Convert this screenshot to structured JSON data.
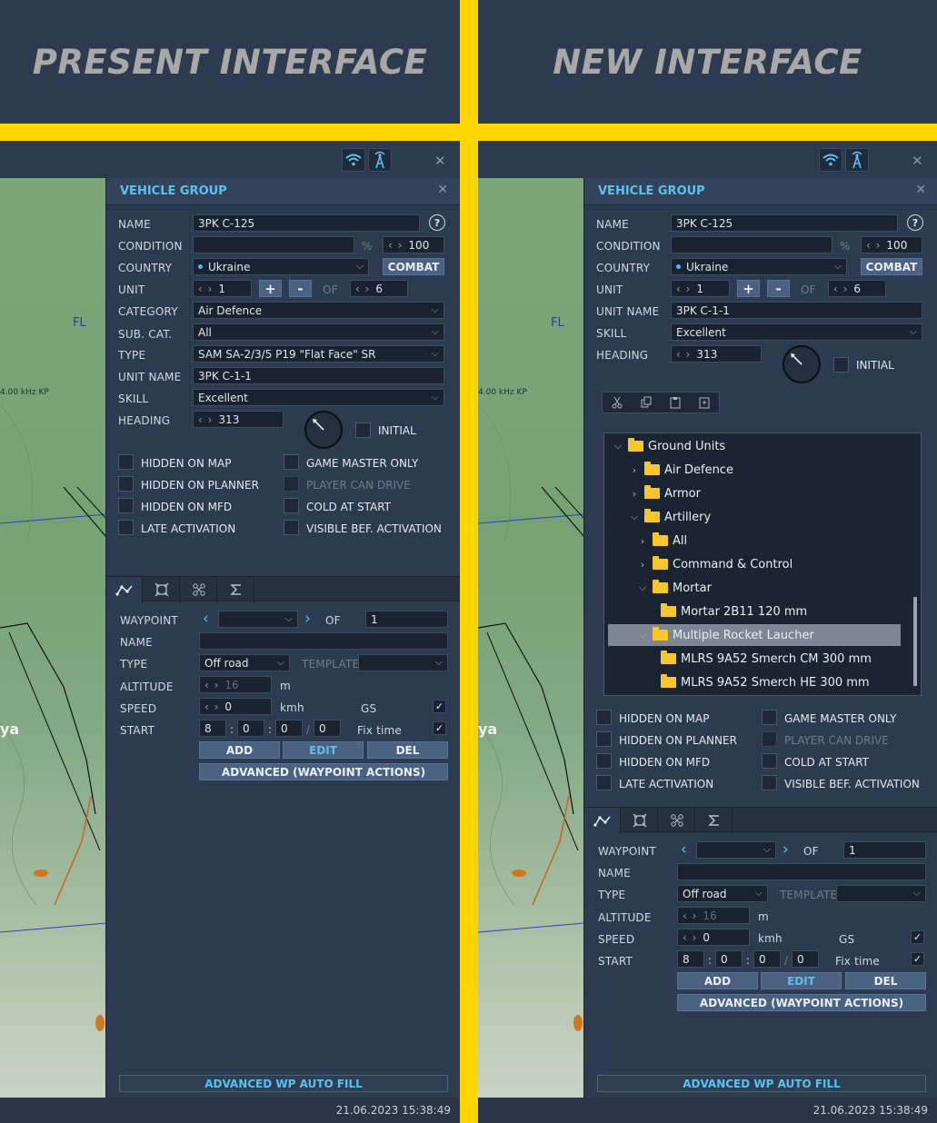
{
  "banner": {
    "left_title": "PRESENT INTERFACE",
    "right_title": "NEW INTERFACE"
  },
  "map": {
    "fl_label": "FL",
    "freq_label": "4.00 kHz KP",
    "place_label": "ya"
  },
  "timestamp": "21.06.2023 15:38:49",
  "panel": {
    "title": "VEHICLE GROUP",
    "name_label": "NAME",
    "name_value": "3PK C-125",
    "help": "?",
    "condition_label": "CONDITION",
    "condition_unit": "%",
    "condition_value": "100",
    "country_label": "COUNTRY",
    "country_value": "Ukraine",
    "combat_label": "COMBAT",
    "unit_label": "UNIT",
    "unit_value": "1",
    "unit_plus": "+",
    "unit_minus": "-",
    "of_label": "OF",
    "unit_total": "6",
    "category_label": "CATEGORY",
    "category_value": "Air Defence",
    "subcat_label": "SUB. CAT.",
    "subcat_value": "All",
    "type_label": "TYPE",
    "type_value": "SAM SA-2/3/5 P19 \"Flat Face\" SR",
    "unit_name_label": "UNIT NAME",
    "unit_name_value": "3PK C-1-1",
    "skill_label": "SKILL",
    "skill_value": "Excellent",
    "heading_label": "HEADING",
    "heading_value": "313",
    "initial_label": "INITIAL",
    "checks": {
      "hidden_map": "HIDDEN ON MAP",
      "hidden_planner": "HIDDEN ON PLANNER",
      "hidden_mfd": "HIDDEN ON MFD",
      "late_activation": "LATE ACTIVATION",
      "gm_only": "GAME MASTER ONLY",
      "player_drive": "PLAYER CAN DRIVE",
      "cold_start": "COLD AT START",
      "visible_bef": "VISIBLE BEF. ACTIVATION"
    },
    "wp": {
      "waypoint_label": "WAYPOINT",
      "of_label": "OF",
      "total": "1",
      "name_label": "NAME",
      "type_label": "TYPE",
      "type_value": "Off road",
      "template_label": "TEMPLATE",
      "altitude_label": "ALTITUDE",
      "altitude_value": "16",
      "altitude_unit": "m",
      "speed_label": "SPEED",
      "speed_value": "0",
      "speed_unit": "kmh",
      "gs_label": "GS",
      "start_label": "START",
      "start_d": "8",
      "start_h": "0",
      "start_m": "0",
      "start_s": "0",
      "colon": ":",
      "slash": "/",
      "fixtime_label": "Fix time",
      "add": "ADD",
      "edit": "EDIT",
      "del": "DEL",
      "advanced": "ADVANCED (WAYPOINT ACTIONS)"
    },
    "autofill": "ADVANCED WP AUTO FILL"
  },
  "tree": {
    "ground_units": "Ground Units",
    "air_defence": "Air Defence",
    "armor": "Armor",
    "artillery": "Artillery",
    "all": "All",
    "command_control": "Command & Control",
    "mortar": "Mortar",
    "mortar_2b11": "Mortar 2B11 120 mm",
    "mrl": "Multiple Rocket Laucher",
    "mlrs_cm": "MLRS 9A52 Smerch CM 300 mm",
    "mlrs_he": "MLRS 9A52 Smerch HE 300 mm"
  }
}
